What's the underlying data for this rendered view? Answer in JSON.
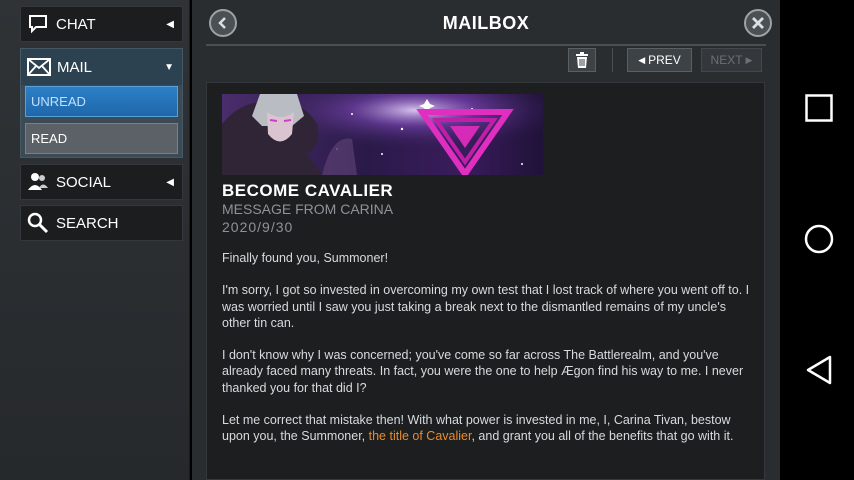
{
  "sidebar": {
    "chat_label": "CHAT",
    "mail_label": "MAIL",
    "unread_label": "UNREAD",
    "read_label": "READ",
    "social_label": "SOCIAL",
    "search_label": "SEARCH"
  },
  "header": {
    "title": "MAILBOX"
  },
  "toolbar": {
    "prev_label": "PREV",
    "next_label": "NEXT"
  },
  "message": {
    "title": "BECOME CAVALIER",
    "from": "MESSAGE FROM CARINA",
    "date": "2020/9/30",
    "p1": "Finally found you, Summoner!",
    "p2": "I'm sorry, I got so invested in overcoming my own test that I lost track of where you went off to. I was worried until I saw you just taking a break next to the dismantled remains of my uncle's other tin can.",
    "p3": "I don't know why I was concerned; you've come so far across The Battlerealm, and you've already faced many threats. In fact, you were the one to help Ægon find his way to me. I never thanked you for that did I?",
    "p4_before": "Let me correct that mistake then! With what power is invested in me, I, Carina Tivan, bestow upon you, the Summoner, ",
    "p4_link": "the title of Cavalier",
    "p4_after": ", and grant you all of the benefits that go with it."
  },
  "colors": {
    "accent_blue": "#2d7fc6",
    "link_orange": "#e98c2b",
    "panel_bg": "#1c1e20"
  },
  "icons": {
    "chat": "chat-bubble-icon",
    "mail": "envelope-icon",
    "social": "people-icon",
    "search": "magnifier-icon",
    "back": "left-arrow-icon",
    "close": "close-icon",
    "delete": "trash-icon"
  }
}
